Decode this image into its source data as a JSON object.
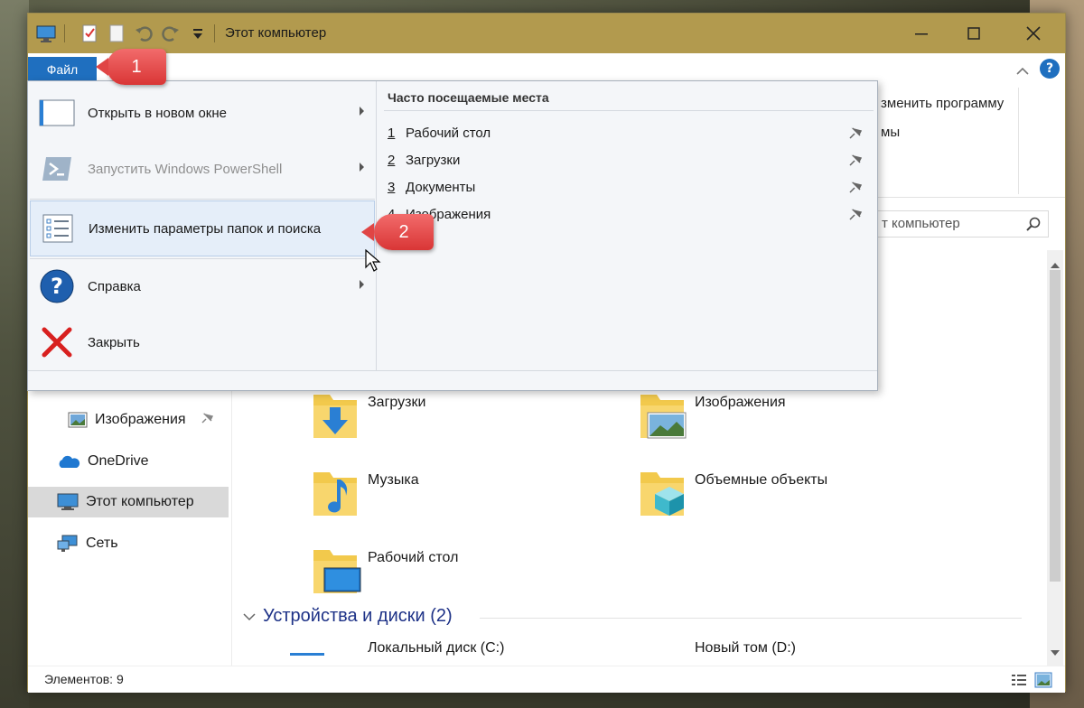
{
  "window": {
    "title": "Этот компьютер",
    "accent": "#b29a4e",
    "file_tab_color": "#1f6fbf"
  },
  "ribbon": {
    "file_tab": "Файл",
    "help_label": "?",
    "partial_text_1": "зменить программу",
    "partial_text_2": "мы"
  },
  "search": {
    "text": "т компьютер"
  },
  "file_menu": {
    "items": [
      {
        "label": "Открыть в новом окне",
        "icon": "new-window-icon"
      },
      {
        "label": "Запустить Windows PowerShell",
        "icon": "powershell-icon"
      },
      {
        "label": "Изменить параметры папок и поиска",
        "icon": "folder-options-icon"
      },
      {
        "label": "Справка",
        "icon": "help-icon"
      },
      {
        "label": "Закрыть",
        "icon": "close-icon"
      }
    ],
    "frequent_title": "Часто посещаемые места",
    "frequent": [
      {
        "num": "1",
        "label": "Рабочий стол"
      },
      {
        "num": "2",
        "label": "Загрузки"
      },
      {
        "num": "3",
        "label": "Документы"
      },
      {
        "num": "4",
        "label": "Изображения"
      }
    ]
  },
  "nav": {
    "items": [
      {
        "label": "Изображения",
        "icon": "pictures-icon"
      },
      {
        "label": "OneDrive",
        "icon": "onedrive-icon"
      },
      {
        "label": "Этот компьютер",
        "icon": "this-pc-icon"
      },
      {
        "label": "Сеть",
        "icon": "network-icon"
      }
    ]
  },
  "folders": [
    {
      "label": "Загрузки",
      "icon": "downloads-folder-icon"
    },
    {
      "label": "Изображения",
      "icon": "pictures-folder-icon"
    },
    {
      "label": "Музыка",
      "icon": "music-folder-icon"
    },
    {
      "label": "Объемные объекты",
      "icon": "3d-objects-folder-icon"
    },
    {
      "label": "Рабочий стол",
      "icon": "desktop-folder-icon"
    }
  ],
  "devices": {
    "heading": "Устройства и диски (2)",
    "drives": [
      {
        "label": "Локальный диск (C:)"
      },
      {
        "label": "Новый том (D:)"
      }
    ]
  },
  "status": {
    "items_count": "Элементов: 9"
  },
  "callouts": [
    {
      "label": "1"
    },
    {
      "label": "2"
    }
  ]
}
